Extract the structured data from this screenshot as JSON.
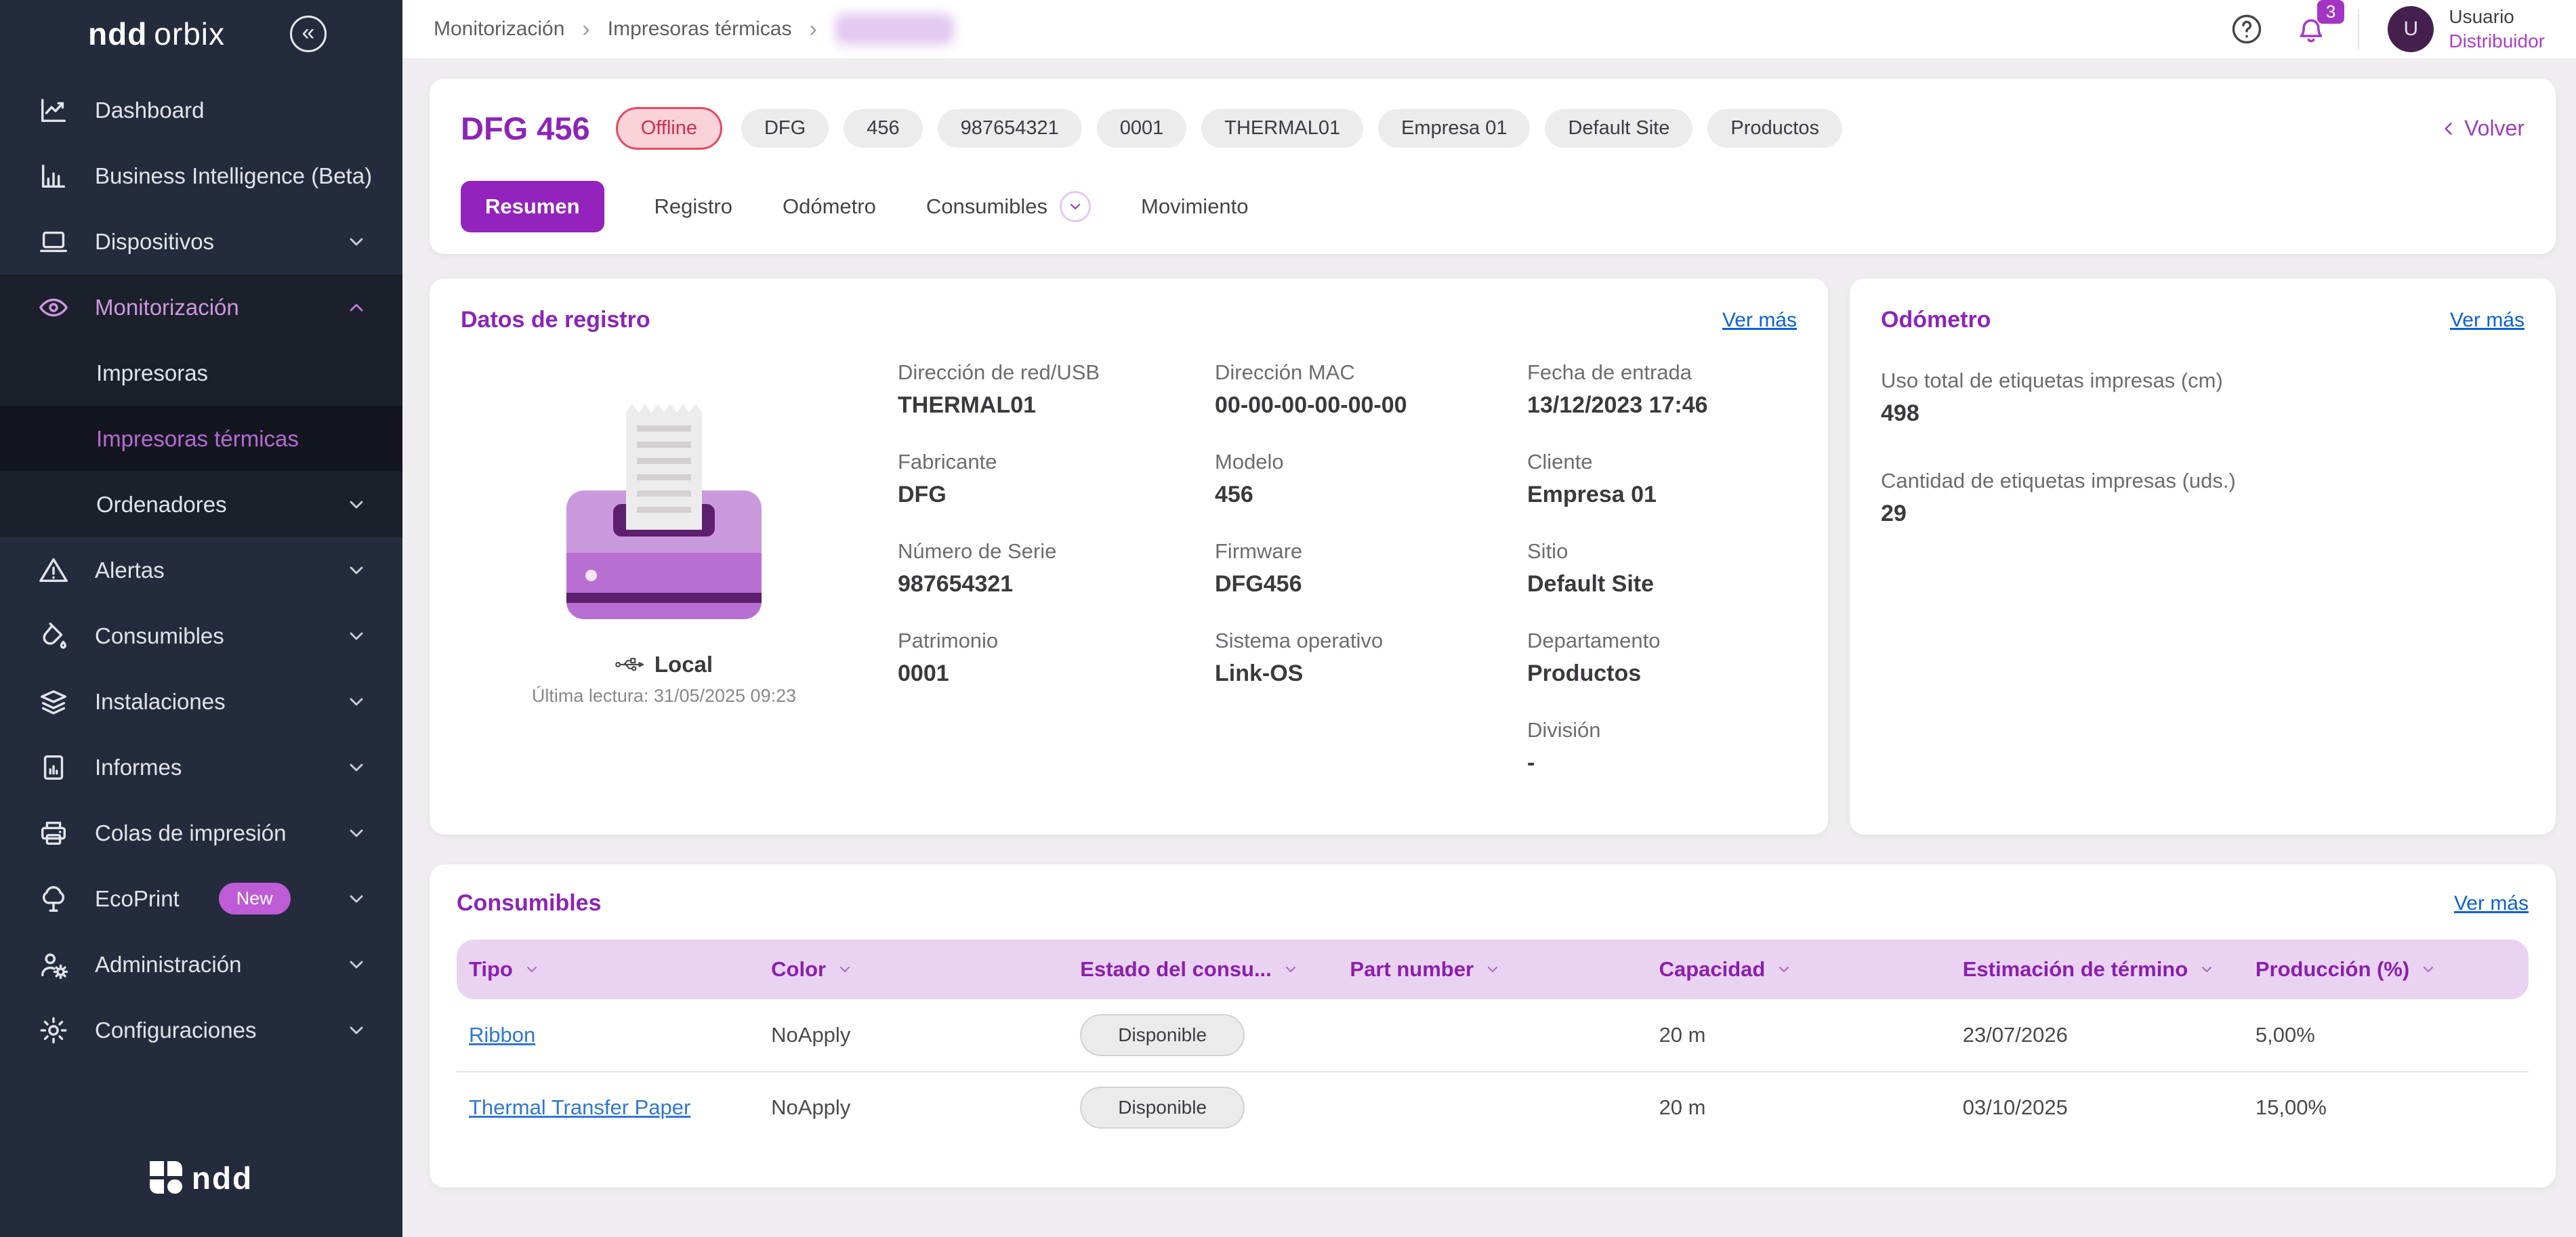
{
  "colors": {
    "accent_purple": "#9423BD",
    "title_purple": "#8C24B8",
    "link_blue": "#0B61D6",
    "sidebar_bg": "#242B3C",
    "offline_red": "#D12D4E",
    "table_header_bg": "#E9D3F0"
  },
  "sidebar": {
    "brand_bold": "ndd",
    "brand_light": "orbix",
    "collapse_glyph": "«",
    "items": [
      {
        "label": "Dashboard"
      },
      {
        "label": "Business Intelligence (Beta)"
      },
      {
        "label": "Dispositivos"
      },
      {
        "label": "Monitorización"
      },
      {
        "label": "Impresoras"
      },
      {
        "label": "Impresoras térmicas"
      },
      {
        "label": "Ordenadores"
      },
      {
        "label": "Alertas"
      },
      {
        "label": "Consumibles"
      },
      {
        "label": "Instalaciones"
      },
      {
        "label": "Informes"
      },
      {
        "label": "Colas de impresión"
      },
      {
        "label": "EcoPrint",
        "badge": "New"
      },
      {
        "label": "Administración"
      },
      {
        "label": "Configuraciones"
      }
    ],
    "footer_brand": "ndd"
  },
  "topbar": {
    "breadcrumb": [
      "Monitorización",
      "Impresoras térmicas"
    ],
    "notification_count": "3",
    "avatar_letter": "U",
    "user_name": "Usuario",
    "user_role": "Distribuidor"
  },
  "header": {
    "title": "DFG 456",
    "status": "Offline",
    "tags": [
      "DFG",
      "456",
      "987654321",
      "0001",
      "THERMAL01",
      "Empresa 01",
      "Default Site",
      "Productos"
    ],
    "back_label": "Volver",
    "tabs": [
      "Resumen",
      "Registro",
      "Odómetro",
      "Consumibles",
      "Movimiento"
    ]
  },
  "registro": {
    "title": "Datos de registro",
    "link": "Ver más",
    "connection": "Local",
    "last_read": "Última lectura: 31/05/2025 09:23",
    "col1": [
      {
        "label": "Dirección de red/USB",
        "value": "THERMAL01"
      },
      {
        "label": "Fabricante",
        "value": "DFG"
      },
      {
        "label": "Número de Serie",
        "value": "987654321"
      },
      {
        "label": "Patrimonio",
        "value": "0001"
      }
    ],
    "col2": [
      {
        "label": "Dirección MAC",
        "value": "00-00-00-00-00-00"
      },
      {
        "label": "Modelo",
        "value": "456"
      },
      {
        "label": "Firmware",
        "value": "DFG456"
      },
      {
        "label": "Sistema operativo",
        "value": "Link-OS"
      }
    ],
    "col3": [
      {
        "label": "Fecha de entrada",
        "value": "13/12/2023 17:46"
      },
      {
        "label": "Cliente",
        "value": "Empresa 01"
      },
      {
        "label": "Sitio",
        "value": "Default Site"
      },
      {
        "label": "Departamento",
        "value": "Productos"
      },
      {
        "label": "División",
        "value": "-"
      }
    ]
  },
  "odometro": {
    "title": "Odómetro",
    "link": "Ver más",
    "metrics": [
      {
        "label": "Uso total de etiquetas impresas (cm)",
        "value": "498"
      },
      {
        "label": "Cantidad de etiquetas impresas (uds.)",
        "value": "29"
      }
    ]
  },
  "consumibles": {
    "title": "Consumibles",
    "link": "Ver más",
    "columns": [
      "Tipo",
      "Color",
      "Estado del consu...",
      "Part number",
      "Capacidad",
      "Estimación de término",
      "Producción (%)"
    ],
    "rows": [
      {
        "tipo": "Ribbon",
        "color": "NoApply",
        "estado": "Disponible",
        "part_number": "",
        "capacidad": "20 m",
        "estimacion": "23/07/2026",
        "produccion": "5,00%"
      },
      {
        "tipo": "Thermal Transfer Paper",
        "color": "NoApply",
        "estado": "Disponible",
        "part_number": "",
        "capacidad": "20 m",
        "estimacion": "03/10/2025",
        "produccion": "15,00%"
      }
    ]
  }
}
